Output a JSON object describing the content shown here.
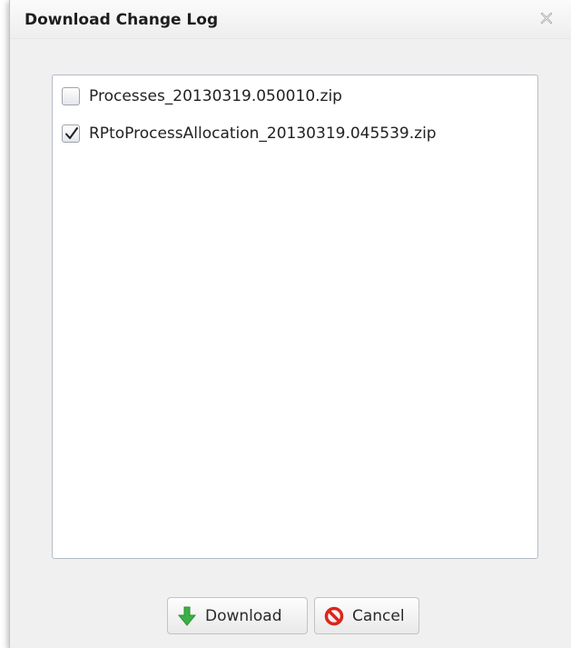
{
  "dialog": {
    "title": "Download Change Log",
    "close_icon": "close-icon"
  },
  "files": [
    {
      "name": "Processes_20130319.050010.zip",
      "checked": false
    },
    {
      "name": "RPtoProcessAllocation_20130319.045539.zip",
      "checked": true
    }
  ],
  "buttons": {
    "download": {
      "label": "Download",
      "icon": "download-arrow-icon",
      "icon_color": "#3cb043"
    },
    "cancel": {
      "label": "Cancel",
      "icon": "cancel-icon",
      "icon_color": "#d9261c"
    }
  }
}
